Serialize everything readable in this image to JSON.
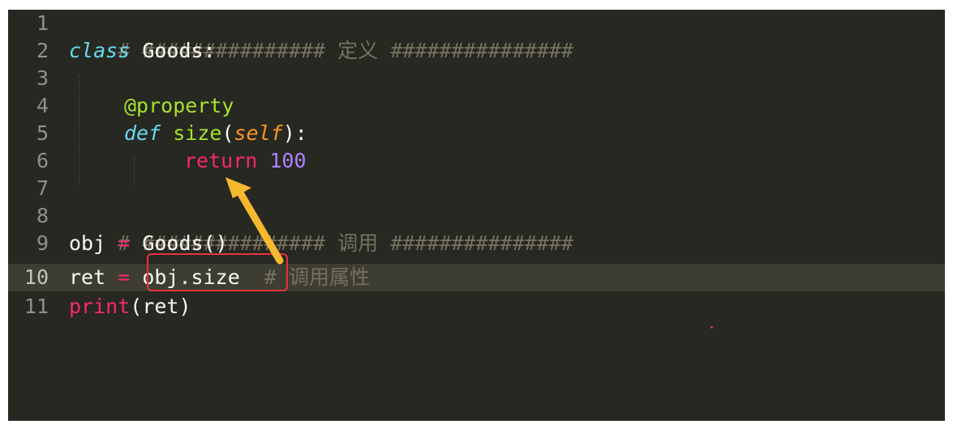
{
  "editor": {
    "line_numbers": [
      "1",
      "2",
      "3",
      "4",
      "5",
      "6",
      "7",
      "8",
      "9",
      "10",
      "11"
    ],
    "lines": {
      "l1": {
        "comment": "# ############### 定义 ###############"
      },
      "l2": {
        "kw": "class",
        "name": " Goods:"
      },
      "l4": {
        "decorator": "@property"
      },
      "l5": {
        "kw": "def",
        "sp": " ",
        "fn": "size",
        "open": "(",
        "param": "self",
        "close": "):"
      },
      "l6": {
        "kw": "return",
        "sp": " ",
        "num": "100"
      },
      "l8": {
        "comment": "# ############### 调用 ###############"
      },
      "l9": {
        "var": "obj ",
        "op": "=",
        "rest": " Goods()"
      },
      "l10": {
        "var": "ret ",
        "op": "=",
        "expr": " obj.size",
        "comment": "  # 调用属性"
      },
      "l11": {
        "fn": "print",
        "rest": "(ret)"
      }
    }
  },
  "annotations": {
    "box_color": "#e8333a",
    "arrow_color": "#f5b82e"
  }
}
